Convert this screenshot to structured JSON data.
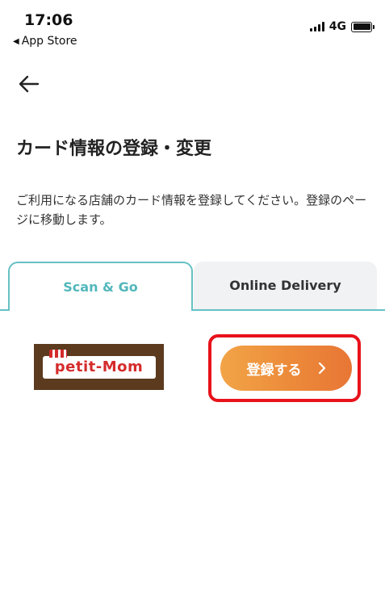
{
  "status_bar": {
    "time": "17:06",
    "back_app": "App Store",
    "network": "4G",
    "icons": [
      "signal-icon",
      "battery-icon"
    ]
  },
  "header": {
    "back_icon": "arrow-left-icon",
    "title": "カード情報の登録・変更",
    "description": "ご利用になる店舗のカード情報を登録してください。登録のページに移動します。"
  },
  "tabs": [
    {
      "label": "Scan & Go",
      "active": true
    },
    {
      "label": "Online Delivery",
      "active": false
    }
  ],
  "store": {
    "logo_text": "petit-Mom"
  },
  "action": {
    "register_label": "登録する",
    "chevron_icon": "chevron-right-icon"
  },
  "colors": {
    "accent_teal": "#66c1c4",
    "button_orange_start": "#f2a447",
    "button_orange_end": "#e87635",
    "highlight_red": "#e8121b",
    "logo_brown": "#5b3a1d"
  }
}
